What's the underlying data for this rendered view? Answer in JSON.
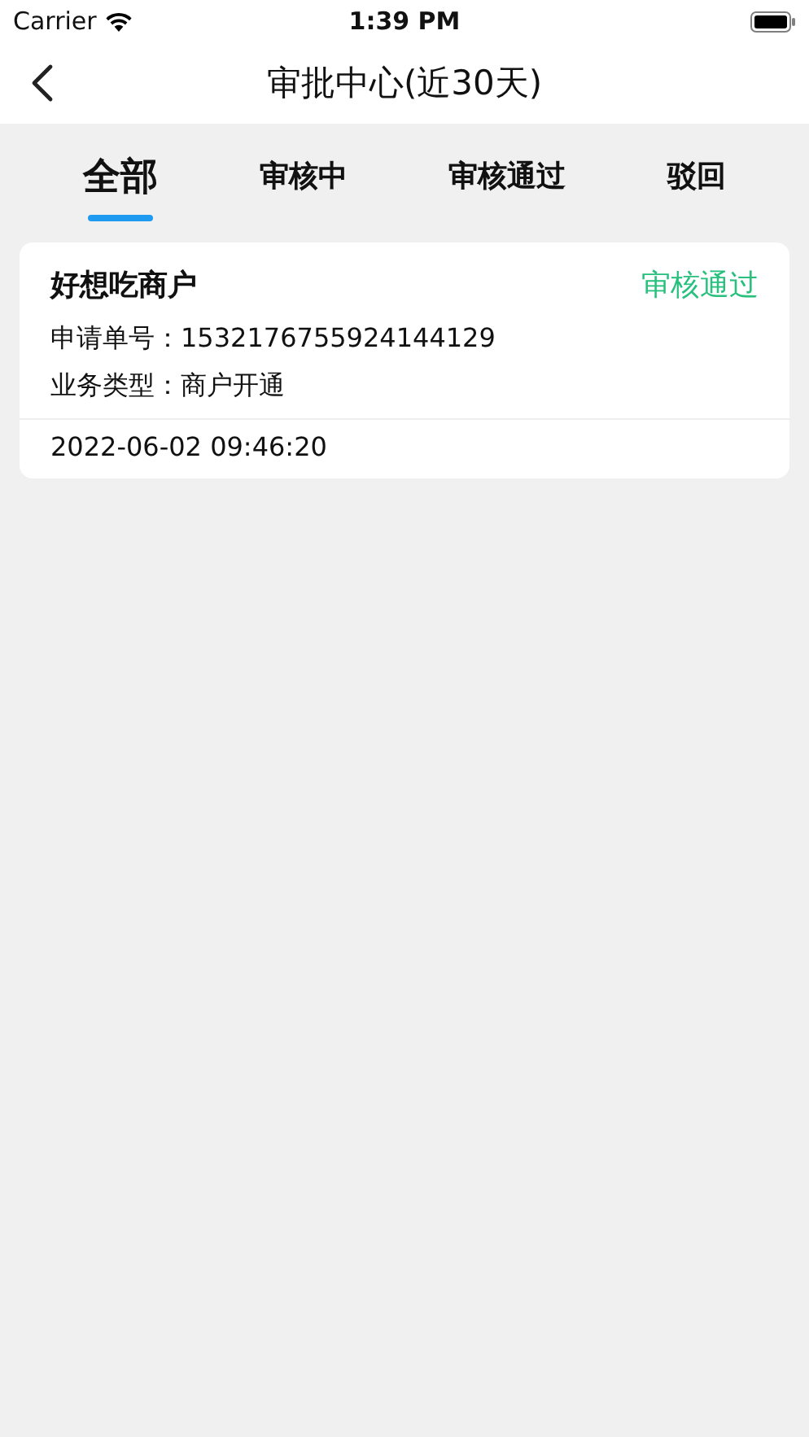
{
  "status_bar": {
    "carrier": "Carrier",
    "time": "1:39 PM"
  },
  "nav": {
    "title": "审批中心(近30天)"
  },
  "tabs": [
    {
      "label": "全部",
      "selected": true
    },
    {
      "label": "审核中",
      "selected": false
    },
    {
      "label": "审核通过",
      "selected": false
    },
    {
      "label": "驳回",
      "selected": false
    }
  ],
  "records": [
    {
      "merchant": "好想吃商户",
      "status": "审核通过",
      "lines": [
        "申请单号：1532176755924144129",
        "业务类型：商户开通"
      ],
      "time": "2022-06-02 09:46:20"
    }
  ]
}
